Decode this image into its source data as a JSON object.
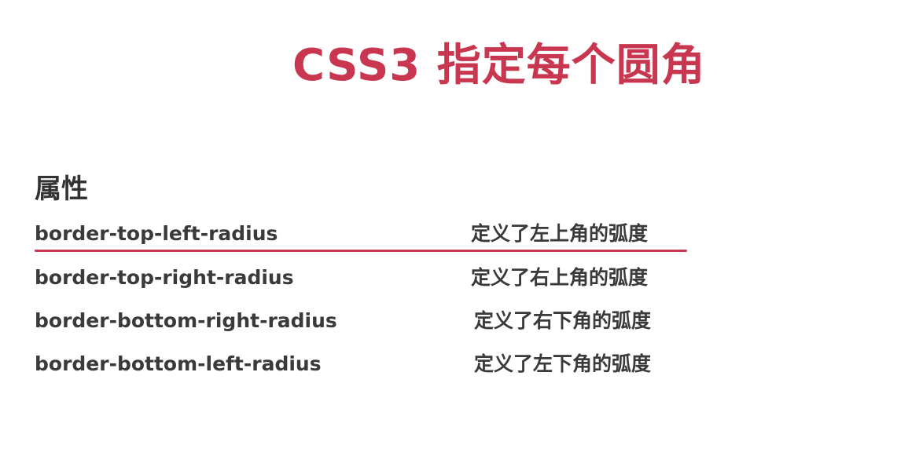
{
  "slide": {
    "title": "CSS3 指定每个圆角",
    "section_heading": "属性",
    "properties": [
      {
        "name": "border-top-left-radius",
        "description": "定义了左上角的弧度"
      },
      {
        "name": "border-top-right-radius",
        "description": "定义了右上角的弧度"
      },
      {
        "name": "border-bottom-right-radius",
        "description": "定义了右下角的弧度"
      },
      {
        "name": "border-bottom-left-radius",
        "description": "定义了左下角的弧度"
      }
    ],
    "colors": {
      "title": "#c9364f",
      "text": "#3a3a3a",
      "highlight_line": "#c9364f"
    }
  }
}
